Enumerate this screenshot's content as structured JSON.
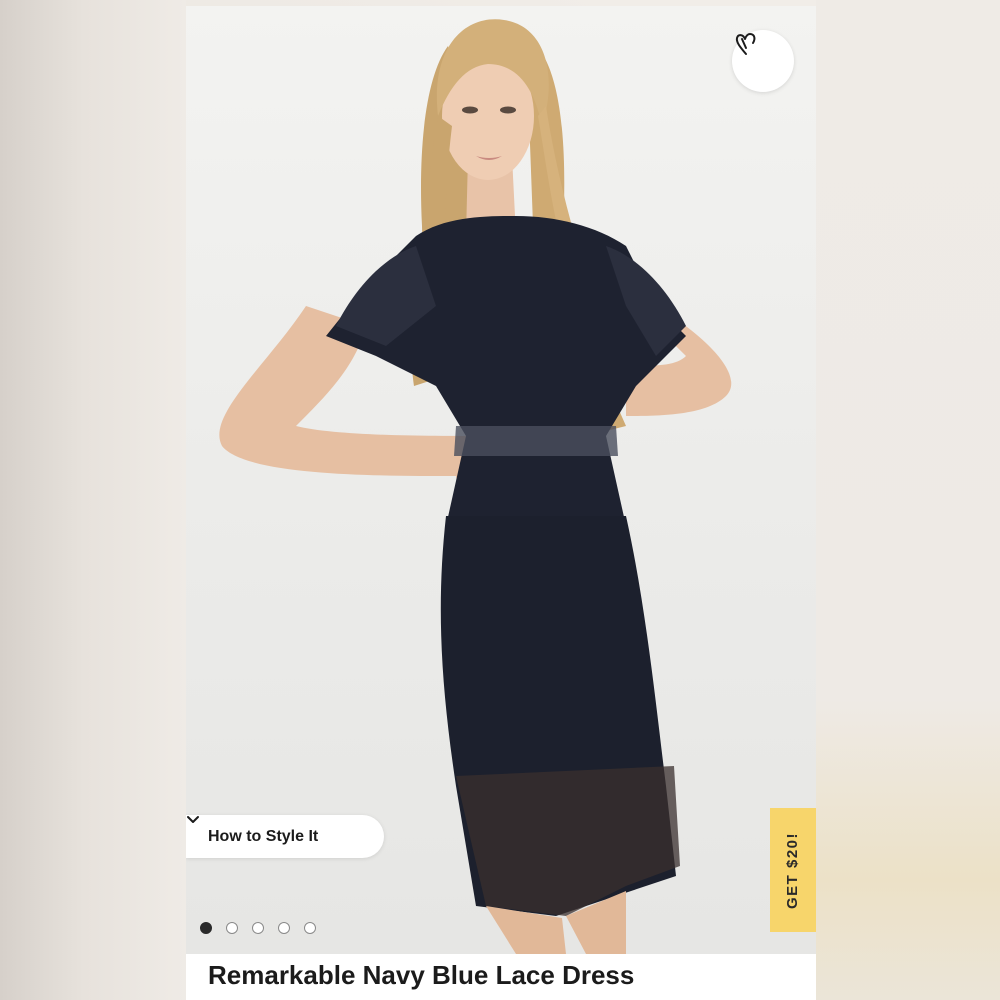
{
  "product": {
    "title": "Remarkable Navy Blue Lace Dress",
    "image_alt": "Model wearing navy blue lace midi dress"
  },
  "buttons": {
    "style_label": "How to Style It",
    "promo_label": "GET $20!"
  },
  "icons": {
    "favorite": "heart-icon",
    "style_toggle": "chevron-down-icon"
  },
  "carousel": {
    "count": 5,
    "active_index": 0
  },
  "colors": {
    "promo": "#f7d56b",
    "dress": "#1e2230",
    "text": "#1b1b1b"
  }
}
